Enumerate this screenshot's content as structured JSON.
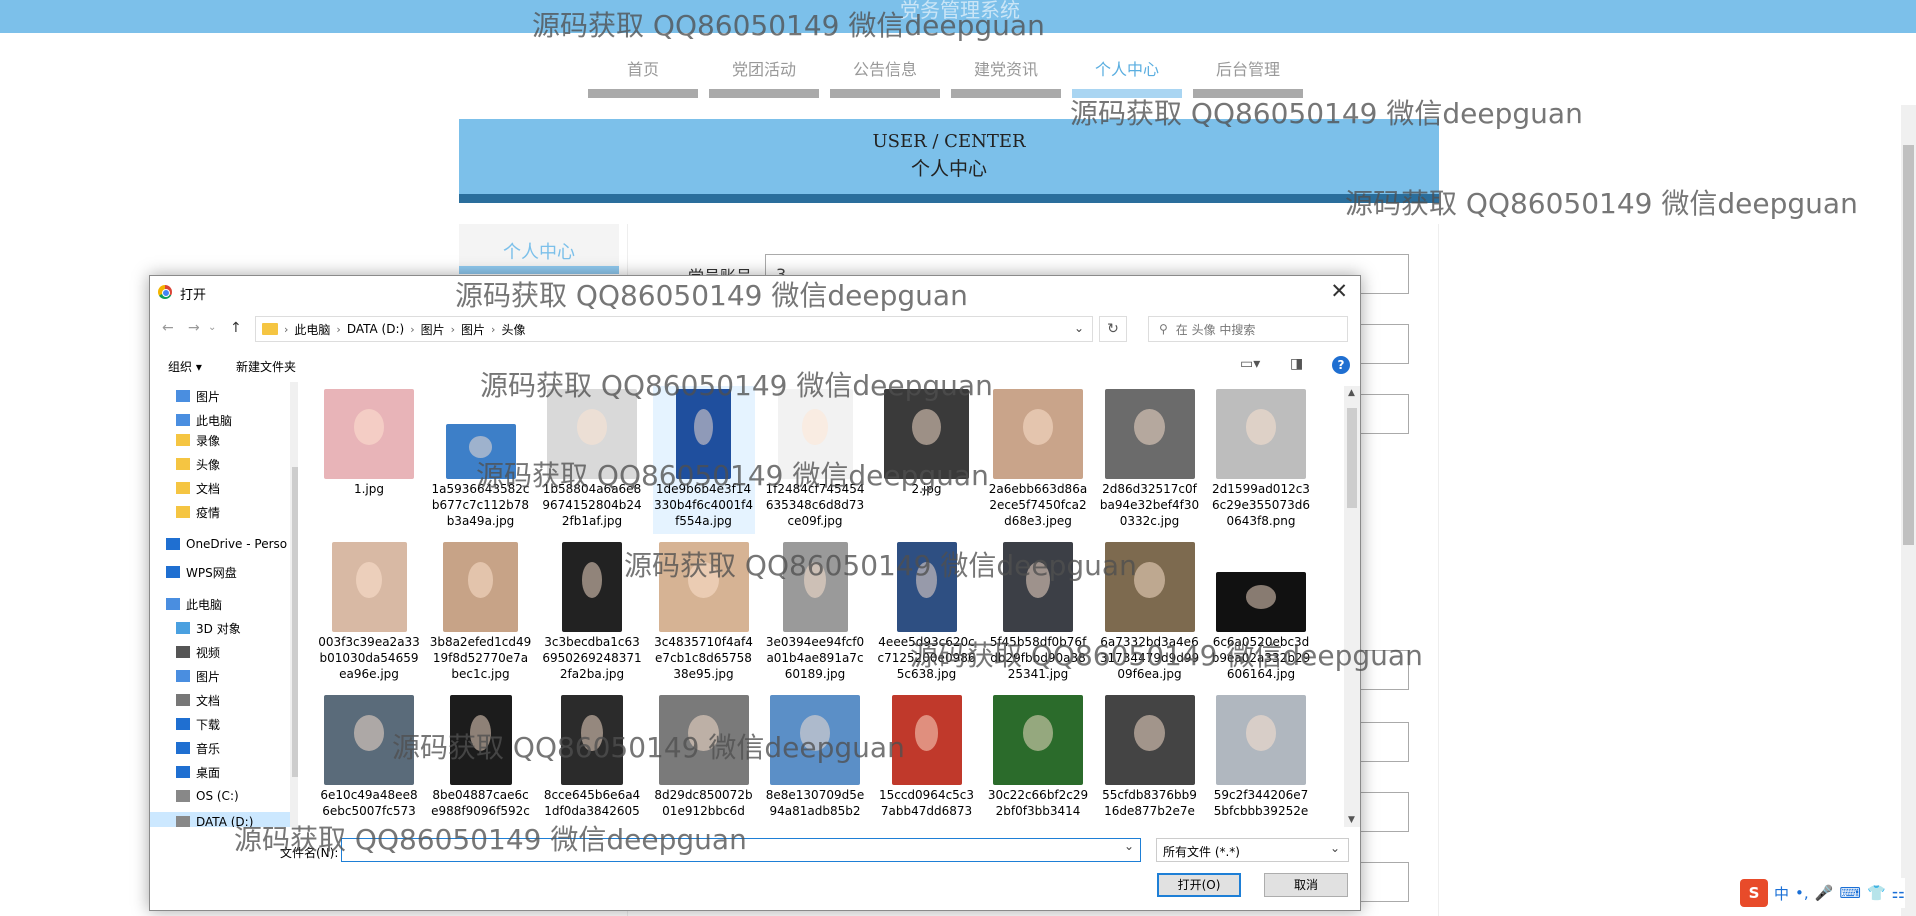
{
  "app": {
    "title": "党务管理系统"
  },
  "nav": [
    {
      "label": "首页"
    },
    {
      "label": "党团活动"
    },
    {
      "label": "公告信息"
    },
    {
      "label": "建党资讯"
    },
    {
      "label": "个人中心"
    },
    {
      "label": "后台管理"
    }
  ],
  "banner": {
    "en": "USER / CENTER",
    "cn": "个人中心"
  },
  "sidebar": {
    "item": "个人中心"
  },
  "form": {
    "account_label": "党员账号",
    "account_value": "3"
  },
  "dialog": {
    "title": "打开",
    "breadcrumb": [
      "此电脑",
      "DATA (D:)",
      "图片",
      "图片",
      "头像"
    ],
    "search_placeholder": "在 头像 中搜索",
    "organize": "组织",
    "new_folder": "新建文件夹",
    "navpane": [
      {
        "label": "图片",
        "icon": "pictures-icon"
      },
      {
        "label": "此电脑",
        "icon": "computer-icon"
      },
      {
        "label": "录像",
        "icon": "folder-icon"
      },
      {
        "label": "头像",
        "icon": "folder-icon"
      },
      {
        "label": "文档",
        "icon": "folder-icon"
      },
      {
        "label": "疫情",
        "icon": "folder-icon"
      },
      {
        "label": "OneDrive - Perso",
        "icon": "cloud-icon"
      },
      {
        "label": "WPS网盘",
        "icon": "cloud-icon"
      },
      {
        "label": "此电脑",
        "icon": "computer-icon"
      },
      {
        "label": "3D 对象",
        "icon": "3d-icon"
      },
      {
        "label": "视频",
        "icon": "video-icon"
      },
      {
        "label": "图片",
        "icon": "pictures-icon"
      },
      {
        "label": "文档",
        "icon": "document-icon"
      },
      {
        "label": "下载",
        "icon": "download-icon"
      },
      {
        "label": "音乐",
        "icon": "music-icon"
      },
      {
        "label": "桌面",
        "icon": "desktop-icon"
      },
      {
        "label": "OS (C:)",
        "icon": "drive-icon"
      },
      {
        "label": "DATA (D:)",
        "icon": "drive-icon"
      }
    ],
    "files": [
      {
        "name": "1.jpg",
        "color": "#e8b4b8"
      },
      {
        "name": "1a5936643582cb677c7c112b78b3a49a.jpg",
        "color": "#3d7fc8"
      },
      {
        "name": "1b58804a6a6e89674152804b242fb1af.jpg",
        "color": "#d9d9d9"
      },
      {
        "name": "1de9b6b4e3f14330b4f6c4001f4f554a.jpg",
        "color": "#1f4f9e"
      },
      {
        "name": "1f2484cf745454635348c6d8d73ce09f.jpg",
        "color": "#f2f2f2"
      },
      {
        "name": "2.jpg",
        "color": "#3a3a3a"
      },
      {
        "name": "2a6ebb663d86a2ece5f7450fca2d68e3.jpeg",
        "color": "#c9a48a"
      },
      {
        "name": "2d86d32517c0fba94e32bef4f300332c.jpg",
        "color": "#6b6b6b"
      },
      {
        "name": "2d1599ad012c36c29e355073d60643f8.png",
        "color": "#bdbdbd"
      },
      {
        "name": "003f3c39ea2a33b01030da54659ea96e.jpg",
        "color": "#d8b9a4"
      },
      {
        "name": "3b8a2efed1cd4919f8d52770e7abec1c.jpg",
        "color": "#c7a387"
      },
      {
        "name": "3c3becdba1c636950269248371 2fa2ba.jpg",
        "color": "#222222"
      },
      {
        "name": "3c4835710f4af4e7cb1c8d6575838e95.jpg",
        "color": "#d6b394"
      },
      {
        "name": "3e0394ee94fcf0a01b4ae891a7c60189.jpg",
        "color": "#9a9a9a"
      },
      {
        "name": "4eee5d93c620cc7125200e09865c638.jpg",
        "color": "#2e4f82"
      },
      {
        "name": "5f45b58df0b76fdb29fbbd90a3825341.jpg",
        "color": "#3c3f46"
      },
      {
        "name": "6a7332bd3a4e631734479d9d9909f6ea.jpg",
        "color": "#7d6a4f"
      },
      {
        "name": "6c6a0520ebc3db9ea02a332b29606164.jpg",
        "color": "#111111"
      },
      {
        "name": "6e10c49a48ee86ebc5007fc573",
        "color": "#5a6b7a"
      },
      {
        "name": "8be04887cae6ce988f9096f592c",
        "color": "#1c1c1c"
      },
      {
        "name": "8cce645b6e6a41df0da3842605",
        "color": "#2b2b2b"
      },
      {
        "name": "8d29dc850072b01e912bbc6d",
        "color": "#7a7a7a"
      },
      {
        "name": "8e8e130709d5e94a81adb85b2",
        "color": "#5b8fc7"
      },
      {
        "name": "15ccd0964c5c37abb47dd6873",
        "color": "#c0392b"
      },
      {
        "name": "30c22c66bf2c292bf0f3bb3414",
        "color": "#2b6b2b"
      },
      {
        "name": "55cfdb8376bb916de877b2e7e",
        "color": "#444444"
      },
      {
        "name": "59c2f344206e75bfcbbb39252e",
        "color": "#b0b7bf"
      }
    ],
    "filename_label": "文件名(N):",
    "filename_value": "",
    "filetype": "所有文件 (*.*)",
    "open_button": "打开(O)",
    "cancel_button": "取消"
  },
  "watermark": "源码获取 QQ86050149 微信deepguan",
  "ime": {
    "items": [
      "中",
      "•,",
      "🎤",
      "⌨",
      "👕",
      "⚏"
    ]
  }
}
